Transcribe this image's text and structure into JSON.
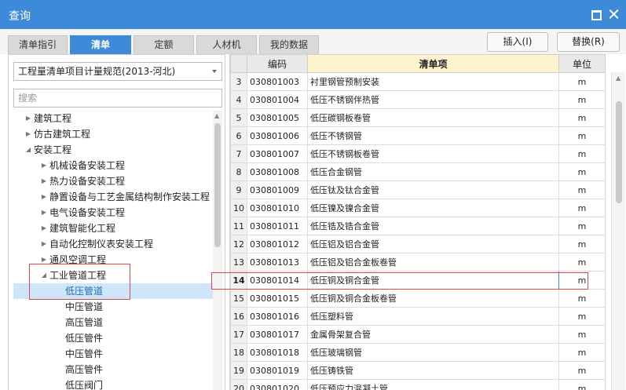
{
  "window": {
    "title": "查询"
  },
  "tabs": [
    "清单指引",
    "清单",
    "定额",
    "人材机",
    "我的数据"
  ],
  "active_tab": "清单",
  "buttons": {
    "insert": "插入(I)",
    "replace": "替换(R)"
  },
  "left": {
    "spec_select": "工程量清单项目计量规范(2013-河北)",
    "search_placeholder": "搜索",
    "tree": [
      {
        "label": "建筑工程",
        "level": 0,
        "state": "collapsed"
      },
      {
        "label": "仿古建筑工程",
        "level": 0,
        "state": "collapsed"
      },
      {
        "label": "安装工程",
        "level": 0,
        "state": "expanded"
      },
      {
        "label": "机械设备安装工程",
        "level": 1,
        "state": "collapsed"
      },
      {
        "label": "热力设备安装工程",
        "level": 1,
        "state": "collapsed"
      },
      {
        "label": "静置设备与工艺金属结构制作安装工程",
        "level": 1,
        "state": "collapsed"
      },
      {
        "label": "电气设备安装工程",
        "level": 1,
        "state": "collapsed"
      },
      {
        "label": "建筑智能化工程",
        "level": 1,
        "state": "collapsed"
      },
      {
        "label": "自动化控制仪表安装工程",
        "level": 1,
        "state": "collapsed"
      },
      {
        "label": "通风空调工程",
        "level": 1,
        "state": "collapsed"
      },
      {
        "label": "工业管道工程",
        "level": 1,
        "state": "expanded"
      },
      {
        "label": "低压管道",
        "level": 2,
        "state": "leaf",
        "selected": true
      },
      {
        "label": "中压管道",
        "level": 2,
        "state": "leaf"
      },
      {
        "label": "高压管道",
        "level": 2,
        "state": "leaf"
      },
      {
        "label": "低压管件",
        "level": 2,
        "state": "leaf"
      },
      {
        "label": "中压管件",
        "level": 2,
        "state": "leaf"
      },
      {
        "label": "高压管件",
        "level": 2,
        "state": "leaf"
      },
      {
        "label": "低压阀门",
        "level": 2,
        "state": "leaf"
      }
    ]
  },
  "grid": {
    "headers": {
      "code": "编码",
      "item": "清单项",
      "unit": "单位"
    },
    "current_row": "14",
    "rows": [
      {
        "num": "3",
        "code": "030801003",
        "name": "衬里钢管预制安装",
        "unit": "m"
      },
      {
        "num": "4",
        "code": "030801004",
        "name": "低压不锈钢伴热管",
        "unit": "m"
      },
      {
        "num": "5",
        "code": "030801005",
        "name": "低压碳钢板卷管",
        "unit": "m"
      },
      {
        "num": "6",
        "code": "030801006",
        "name": "低压不锈钢管",
        "unit": "m"
      },
      {
        "num": "7",
        "code": "030801007",
        "name": "低压不锈钢板卷管",
        "unit": "m"
      },
      {
        "num": "8",
        "code": "030801008",
        "name": "低压合金钢管",
        "unit": "m"
      },
      {
        "num": "9",
        "code": "030801009",
        "name": "低压钛及钛合金管",
        "unit": "m"
      },
      {
        "num": "10",
        "code": "030801010",
        "name": "低压镍及镍合金管",
        "unit": "m"
      },
      {
        "num": "11",
        "code": "030801011",
        "name": "低压锆及锆合金管",
        "unit": "m"
      },
      {
        "num": "12",
        "code": "030801012",
        "name": "低压铝及铝合金管",
        "unit": "m"
      },
      {
        "num": "13",
        "code": "030801013",
        "name": "低压铝及铝合金板卷管",
        "unit": "m"
      },
      {
        "num": "14",
        "code": "030801014",
        "name": "低压铜及铜合金管",
        "unit": "m"
      },
      {
        "num": "15",
        "code": "030801015",
        "name": "低压铜及铜合金板卷管",
        "unit": "m"
      },
      {
        "num": "16",
        "code": "030801016",
        "name": "低压塑料管",
        "unit": "m"
      },
      {
        "num": "17",
        "code": "030801017",
        "name": "金属骨架复合管",
        "unit": "m"
      },
      {
        "num": "18",
        "code": "030801018",
        "name": "低压玻璃钢管",
        "unit": "m"
      },
      {
        "num": "19",
        "code": "030801019",
        "name": "低压铸铁管",
        "unit": "m"
      },
      {
        "num": "20",
        "code": "030801020",
        "name": "低压预应力混凝土管",
        "unit": "m"
      }
    ]
  }
}
